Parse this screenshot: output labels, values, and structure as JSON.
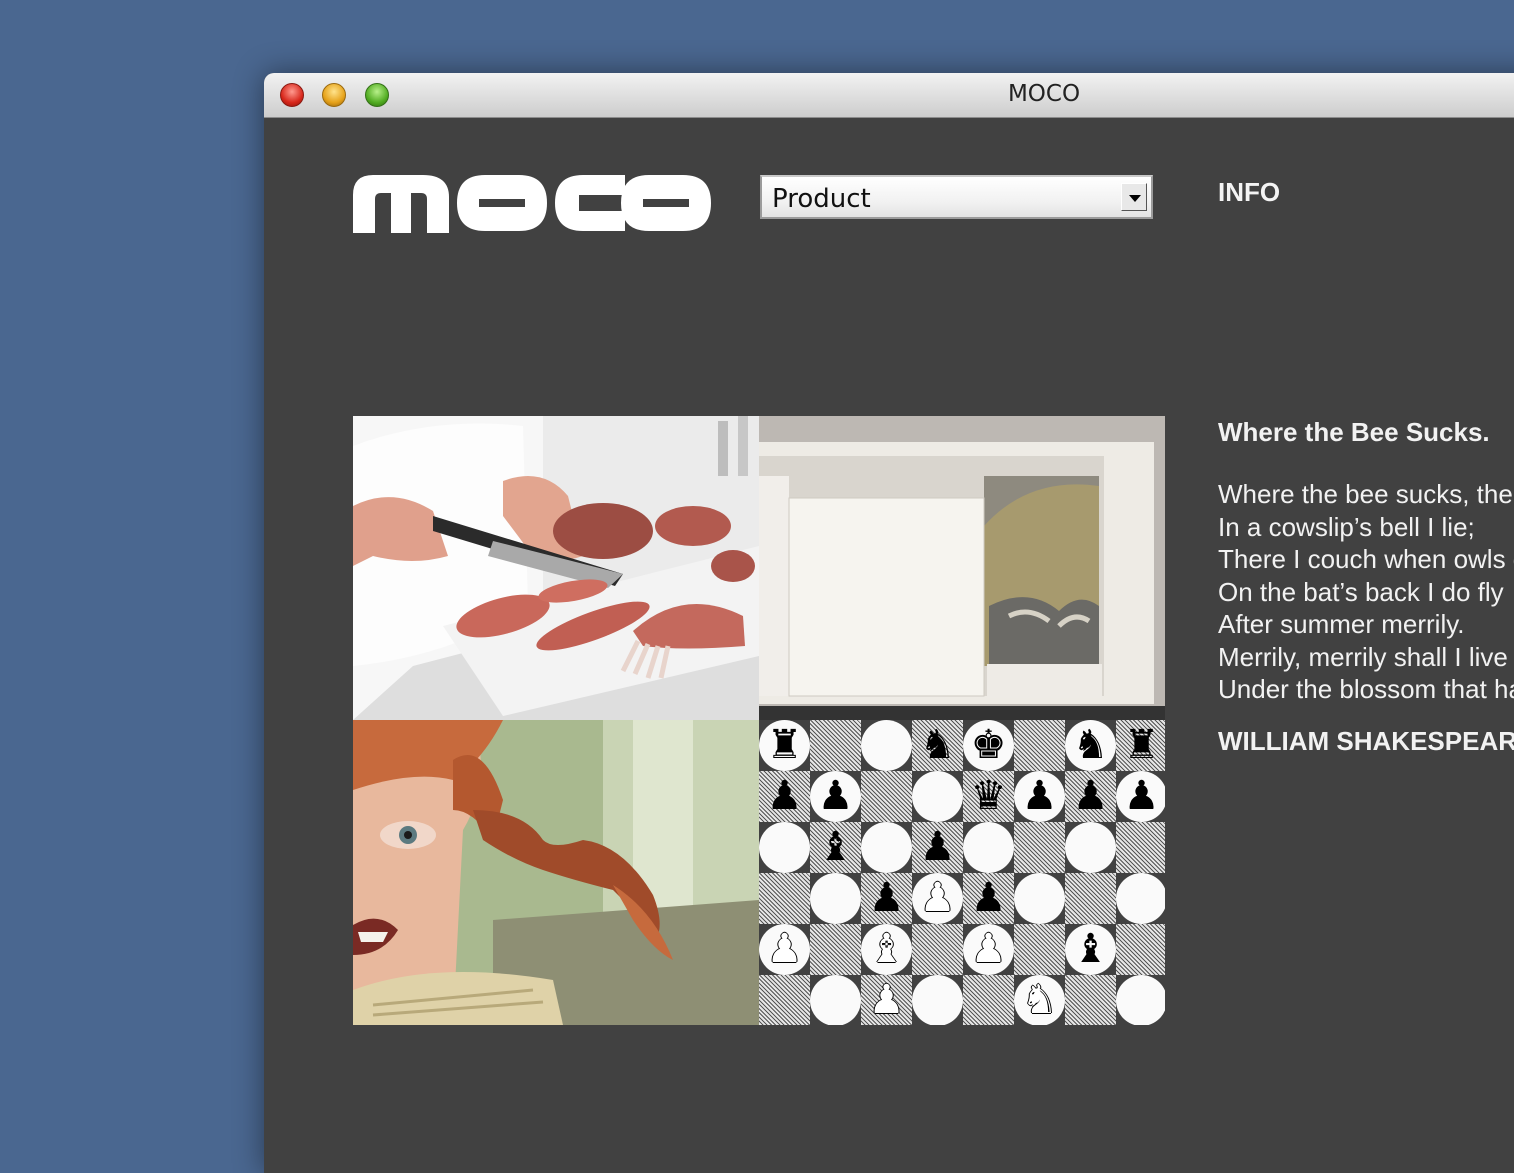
{
  "window": {
    "title": "MOCO"
  },
  "header": {
    "logo_text": "moco",
    "dropdown": {
      "selected": "Product"
    },
    "info_label": "INFO"
  },
  "gallery": {
    "images": [
      {
        "name": "chef-cutting-meat-photo"
      },
      {
        "name": "white-box-drawer-photo"
      },
      {
        "name": "girl-with-braids-photo"
      },
      {
        "name": "chess-board-diagram"
      }
    ]
  },
  "poem": {
    "title": "Where the Bee Sucks.",
    "lines": [
      "Where the bee sucks, there suck I:",
      "In a cowslip’s bell I lie;",
      "There I couch when owls do cry.",
      "On the bat’s back I do fly",
      "After summer merrily.",
      "Merrily, merrily shall I live now",
      "Under the blossom that hangs on the bough."
    ],
    "author": "WILLIAM SHAKESPEARE"
  },
  "colors": {
    "desktop": "#4a6790",
    "window_bg": "#414141",
    "text": "#f2f2f2"
  }
}
